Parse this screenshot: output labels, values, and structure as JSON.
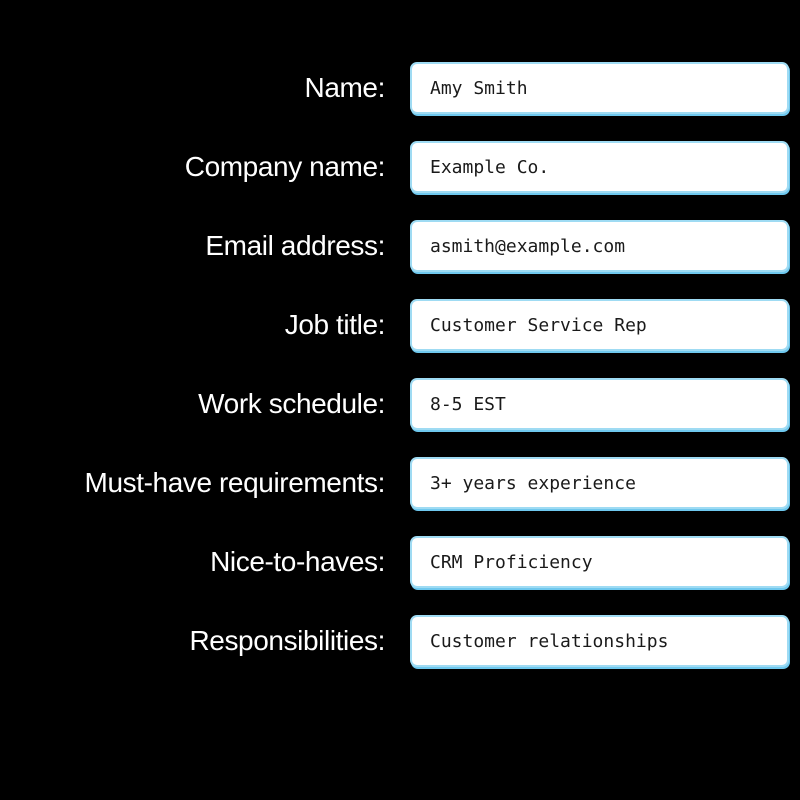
{
  "page": {
    "background_color": "#000000",
    "label_color": "#ffffff",
    "field_background_color": "#ffffff",
    "field_border_color": "#9fdbf3",
    "field_shadow_color": "#6fc8ee",
    "field_text_color": "#1a1a1a"
  },
  "form": {
    "fields": [
      {
        "label": "Name:",
        "value": "Amy Smith"
      },
      {
        "label": "Company name:",
        "value": "Example Co."
      },
      {
        "label": "Email address:",
        "value": "asmith@example.com"
      },
      {
        "label": "Job title:",
        "value": "Customer Service Rep"
      },
      {
        "label": "Work schedule:",
        "value": "8-5 EST"
      },
      {
        "label": "Must-have requirements:",
        "value": "3+ years experience"
      },
      {
        "label": "Nice-to-haves:",
        "value": "CRM Proficiency"
      },
      {
        "label": "Responsibilities:",
        "value": "Customer relationships"
      }
    ]
  }
}
